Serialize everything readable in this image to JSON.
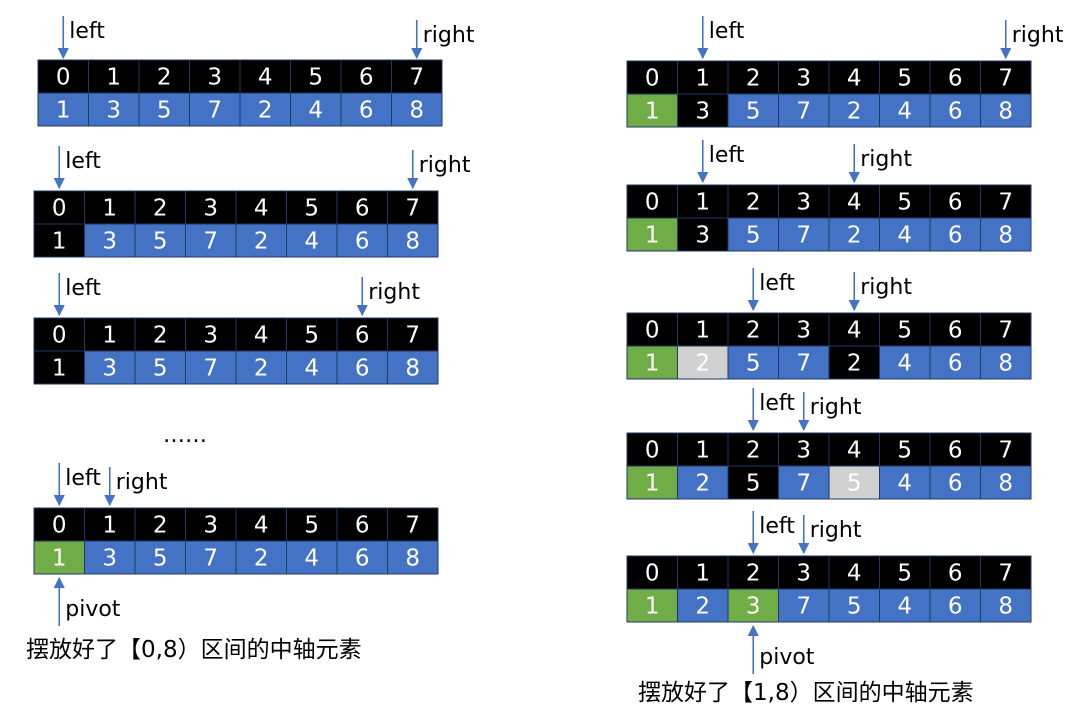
{
  "colors": {
    "index": "#000000",
    "value": "#4472C4",
    "black": "#000000",
    "green": "#70AD47",
    "gray": "#D0D0D0",
    "arrow": "#4472C4",
    "border": "#1F3864"
  },
  "labels": {
    "left": "left",
    "right": "right",
    "pivot": "pivot",
    "dots": "……"
  },
  "captions": {
    "left_column": "摆放好了【0,8）区间的中轴元素",
    "right_column": "摆放好了【1,8）区间的中轴元素"
  },
  "arrays": [
    {
      "id": "l1",
      "indices": [
        "0",
        "1",
        "2",
        "3",
        "4",
        "5",
        "6",
        "7"
      ],
      "values": [
        "1",
        "3",
        "5",
        "7",
        "2",
        "4",
        "6",
        "8"
      ],
      "cell_colors": [
        "value",
        "value",
        "value",
        "value",
        "value",
        "value",
        "value",
        "value"
      ],
      "pointers": [
        {
          "text": "left",
          "at": 0
        },
        {
          "text": "right",
          "at": 7
        }
      ]
    },
    {
      "id": "l2",
      "indices": [
        "0",
        "1",
        "2",
        "3",
        "4",
        "5",
        "6",
        "7"
      ],
      "values": [
        "1",
        "3",
        "5",
        "7",
        "2",
        "4",
        "6",
        "8"
      ],
      "cell_colors": [
        "black",
        "value",
        "value",
        "value",
        "value",
        "value",
        "value",
        "value"
      ],
      "pointers": [
        {
          "text": "left",
          "at": 0
        },
        {
          "text": "right",
          "at": 7
        }
      ]
    },
    {
      "id": "l3",
      "indices": [
        "0",
        "1",
        "2",
        "3",
        "4",
        "5",
        "6",
        "7"
      ],
      "values": [
        "1",
        "3",
        "5",
        "7",
        "2",
        "4",
        "6",
        "8"
      ],
      "cell_colors": [
        "black",
        "value",
        "value",
        "value",
        "value",
        "value",
        "value",
        "value"
      ],
      "pointers": [
        {
          "text": "left",
          "at": 0
        },
        {
          "text": "right",
          "at": 6
        }
      ]
    },
    {
      "id": "l4",
      "indices": [
        "0",
        "1",
        "2",
        "3",
        "4",
        "5",
        "6",
        "7"
      ],
      "values": [
        "1",
        "3",
        "5",
        "7",
        "2",
        "4",
        "6",
        "8"
      ],
      "cell_colors": [
        "green",
        "value",
        "value",
        "value",
        "value",
        "value",
        "value",
        "value"
      ],
      "pointers": [
        {
          "text": "left",
          "at": 0
        },
        {
          "text": "right",
          "at": 1
        }
      ],
      "pivot_at": 0
    },
    {
      "id": "r1",
      "indices": [
        "0",
        "1",
        "2",
        "3",
        "4",
        "5",
        "6",
        "7"
      ],
      "values": [
        "1",
        "3",
        "5",
        "7",
        "2",
        "4",
        "6",
        "8"
      ],
      "cell_colors": [
        "green",
        "black",
        "value",
        "value",
        "value",
        "value",
        "value",
        "value"
      ],
      "pointers": [
        {
          "text": "left",
          "at": 1
        },
        {
          "text": "right",
          "at": 7
        }
      ]
    },
    {
      "id": "r2",
      "indices": [
        "0",
        "1",
        "2",
        "3",
        "4",
        "5",
        "6",
        "7"
      ],
      "values": [
        "1",
        "3",
        "5",
        "7",
        "2",
        "4",
        "6",
        "8"
      ],
      "cell_colors": [
        "green",
        "black",
        "value",
        "value",
        "value",
        "value",
        "value",
        "value"
      ],
      "pointers": [
        {
          "text": "left",
          "at": 1
        },
        {
          "text": "right",
          "at": 4
        }
      ]
    },
    {
      "id": "r3",
      "indices": [
        "0",
        "1",
        "2",
        "3",
        "4",
        "5",
        "6",
        "7"
      ],
      "values": [
        "1",
        "2",
        "5",
        "7",
        "2",
        "4",
        "6",
        "8"
      ],
      "cell_colors": [
        "green",
        "gray",
        "value",
        "value",
        "black",
        "value",
        "value",
        "value"
      ],
      "pointers": [
        {
          "text": "left",
          "at": 2
        },
        {
          "text": "right",
          "at": 4
        }
      ]
    },
    {
      "id": "r4",
      "indices": [
        "0",
        "1",
        "2",
        "3",
        "4",
        "5",
        "6",
        "7"
      ],
      "values": [
        "1",
        "2",
        "5",
        "7",
        "5",
        "4",
        "6",
        "8"
      ],
      "cell_colors": [
        "green",
        "value",
        "black",
        "value",
        "gray",
        "value",
        "value",
        "value"
      ],
      "pointers": [
        {
          "text": "left",
          "at": 2
        },
        {
          "text": "right",
          "at": 3
        }
      ]
    },
    {
      "id": "r5",
      "indices": [
        "0",
        "1",
        "2",
        "3",
        "4",
        "5",
        "6",
        "7"
      ],
      "values": [
        "1",
        "2",
        "3",
        "7",
        "5",
        "4",
        "6",
        "8"
      ],
      "cell_colors": [
        "green",
        "value",
        "green",
        "value",
        "value",
        "value",
        "value",
        "value"
      ],
      "pointers": [
        {
          "text": "left",
          "at": 2
        },
        {
          "text": "right",
          "at": 3
        }
      ],
      "pivot_at": 2
    }
  ]
}
